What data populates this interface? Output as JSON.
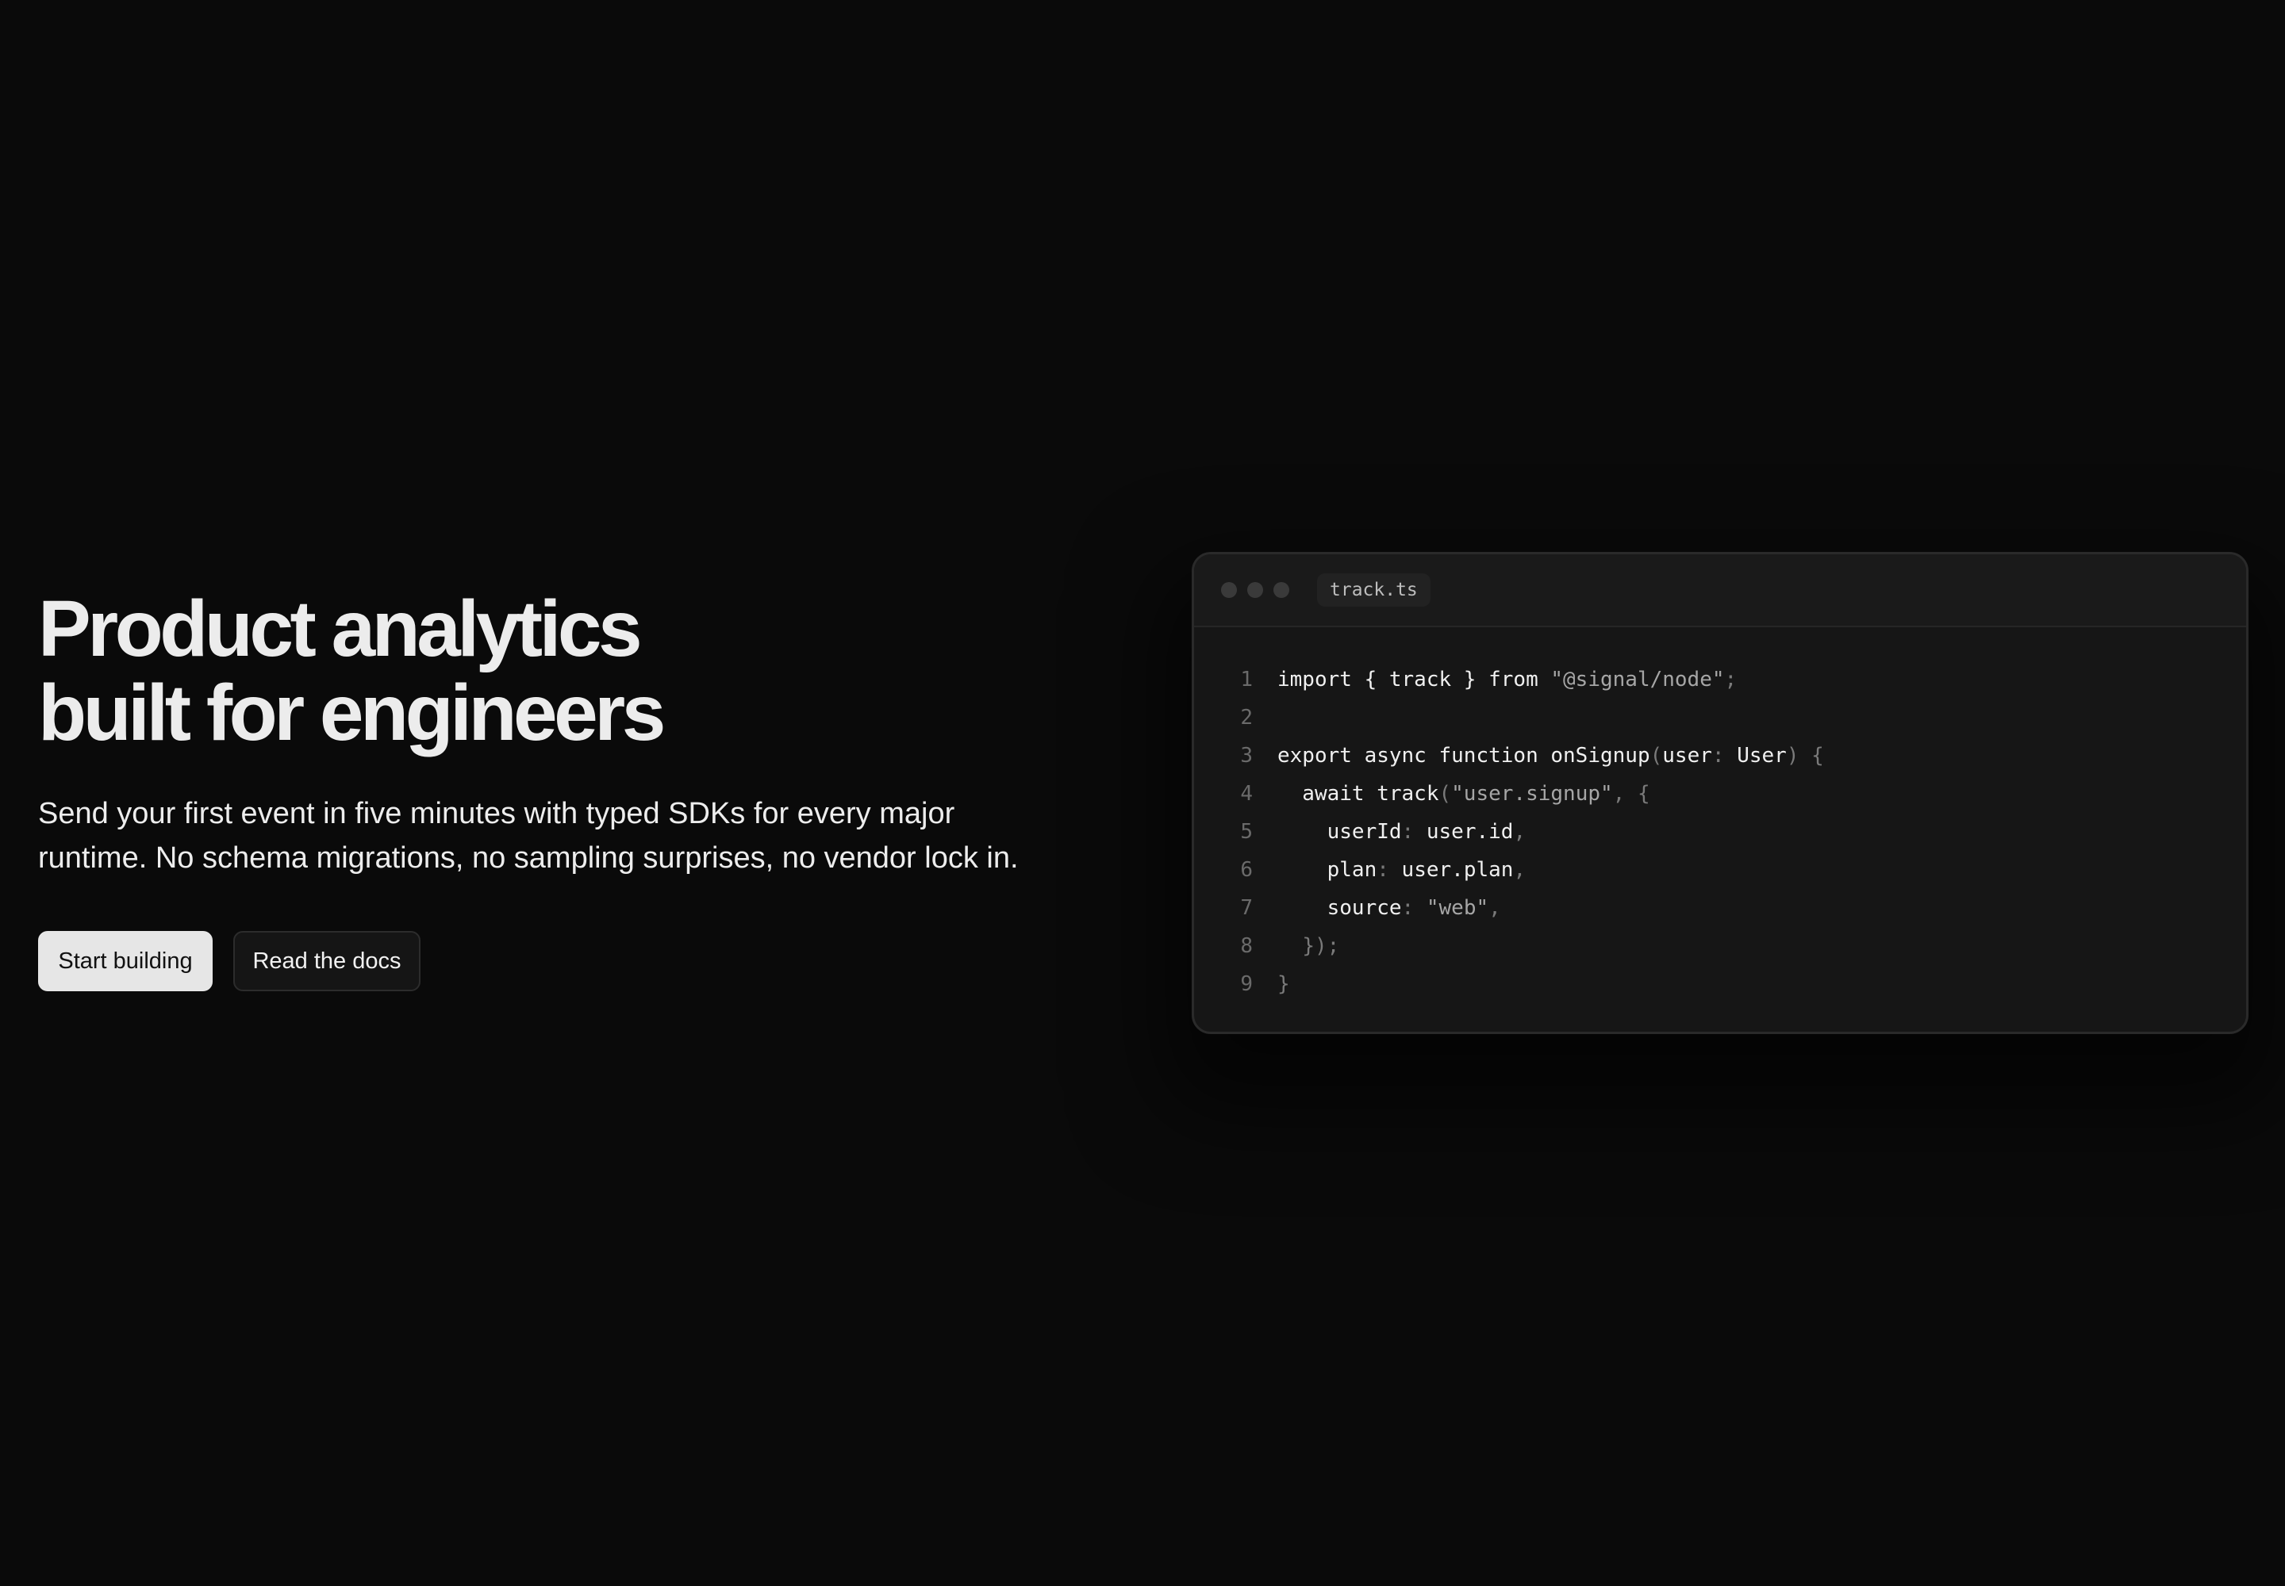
{
  "hero": {
    "title_lines": [
      "Product analytics",
      "built for engineers"
    ],
    "subtitle_lines": [
      "Send your first event in five minutes with typed SDKs for every major",
      "runtime. No schema migrations, no sampling surprises, no vendor lock in."
    ],
    "primary_button": "Start building",
    "secondary_button": "Read the docs"
  },
  "code_window": {
    "filename": "track.ts",
    "lines": [
      {
        "num": "1",
        "parts": [
          "import { track } from ",
          "\"@signal/node\"",
          ";"
        ]
      },
      {
        "num": "2",
        "parts": []
      },
      {
        "num": "3",
        "parts": [
          "export async function onSignup",
          "(",
          "user",
          ": ",
          "User",
          ") {"
        ]
      },
      {
        "num": "4",
        "parts": [
          "  await track",
          "(",
          "\"user.signup\"",
          ", {"
        ]
      },
      {
        "num": "5",
        "parts": [
          "    userId",
          ": ",
          "user.id",
          ","
        ]
      },
      {
        "num": "6",
        "parts": [
          "    plan",
          ": ",
          "user.plan",
          ","
        ]
      },
      {
        "num": "7",
        "parts": [
          "    source",
          ": ",
          "\"web\"",
          ","
        ]
      },
      {
        "num": "8",
        "parts": [
          "  ",
          "});"
        ]
      },
      {
        "num": "9",
        "parts": [
          "}"
        ]
      }
    ]
  },
  "colors": {
    "background": "#0a0a0a",
    "panel": "#161616",
    "primary_button": "#e6e6e6",
    "code_string": "#a6a6a6",
    "code_punctuation": "#7a7a7a"
  }
}
